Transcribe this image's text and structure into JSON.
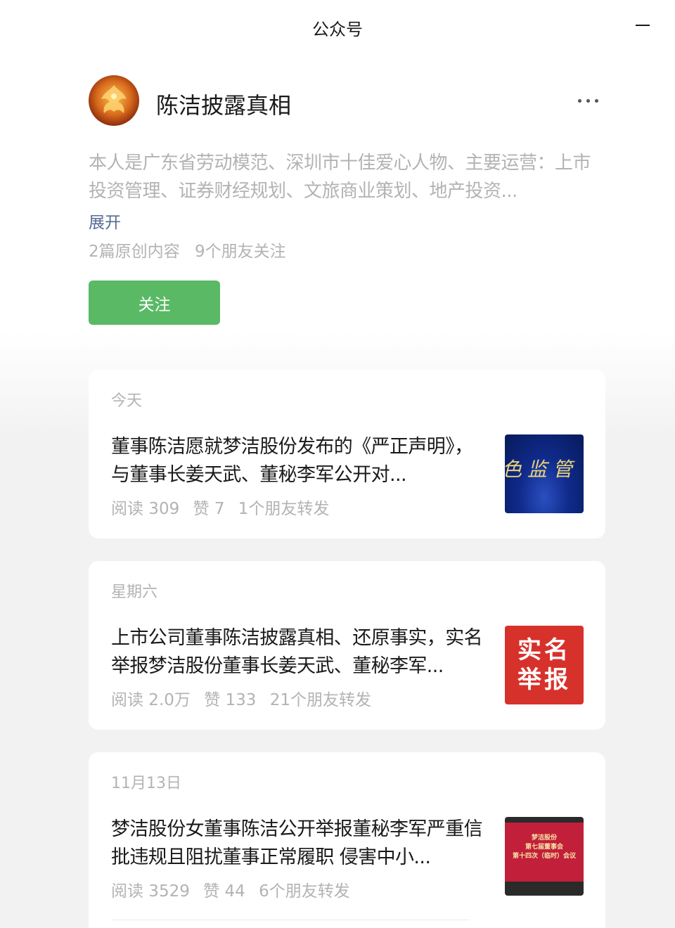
{
  "window": {
    "title": "公众号"
  },
  "profile": {
    "name": "陈洁披露真相",
    "description": "本人是广东省劳动模范、深圳市十佳爱心人物、主要运营：上市投资管理、证券财经规划、文旅商业策划、地产投资...",
    "expand_label": "展开",
    "original_count": "2篇原创内容",
    "friends_follow": "9个朋友关注",
    "follow_label": "关注"
  },
  "articles": [
    {
      "date": "今天",
      "title": "董事陈洁愿就梦洁股份发布的《严正声明》，与董事长姜天武、董秘李军公开对...",
      "reads": "阅读 309",
      "likes": "赞 7",
      "shares": "1个朋友转发",
      "thumb_text": "色监管 ",
      "thumb_color": "#0f2a8a"
    },
    {
      "date": "星期六",
      "title": "上市公司董事陈洁披露真相、还原事实，实名举报梦洁股份董事长姜天武、董秘李军...",
      "reads": "阅读 2.0万",
      "likes": "赞 133",
      "shares": "21个朋友转发",
      "thumb_text": "实名举报",
      "thumb_color": "#d7312b"
    },
    {
      "date": "11月13日",
      "title": "梦洁股份女董事陈洁公开举报董秘李军严重信批违规且阻扰董事正常履职 侵害中小...",
      "reads": "阅读 3529",
      "likes": "赞 44",
      "shares": "6个朋友转发",
      "thumb_lines": [
        "梦洁股份",
        "第七届董事会",
        "第十四次（临时）会议"
      ],
      "thumb_color": "#c21f3a"
    }
  ],
  "colors": {
    "follow_button": "#5ab965",
    "link": "#576b95",
    "muted_text": "#b3b3b3"
  }
}
